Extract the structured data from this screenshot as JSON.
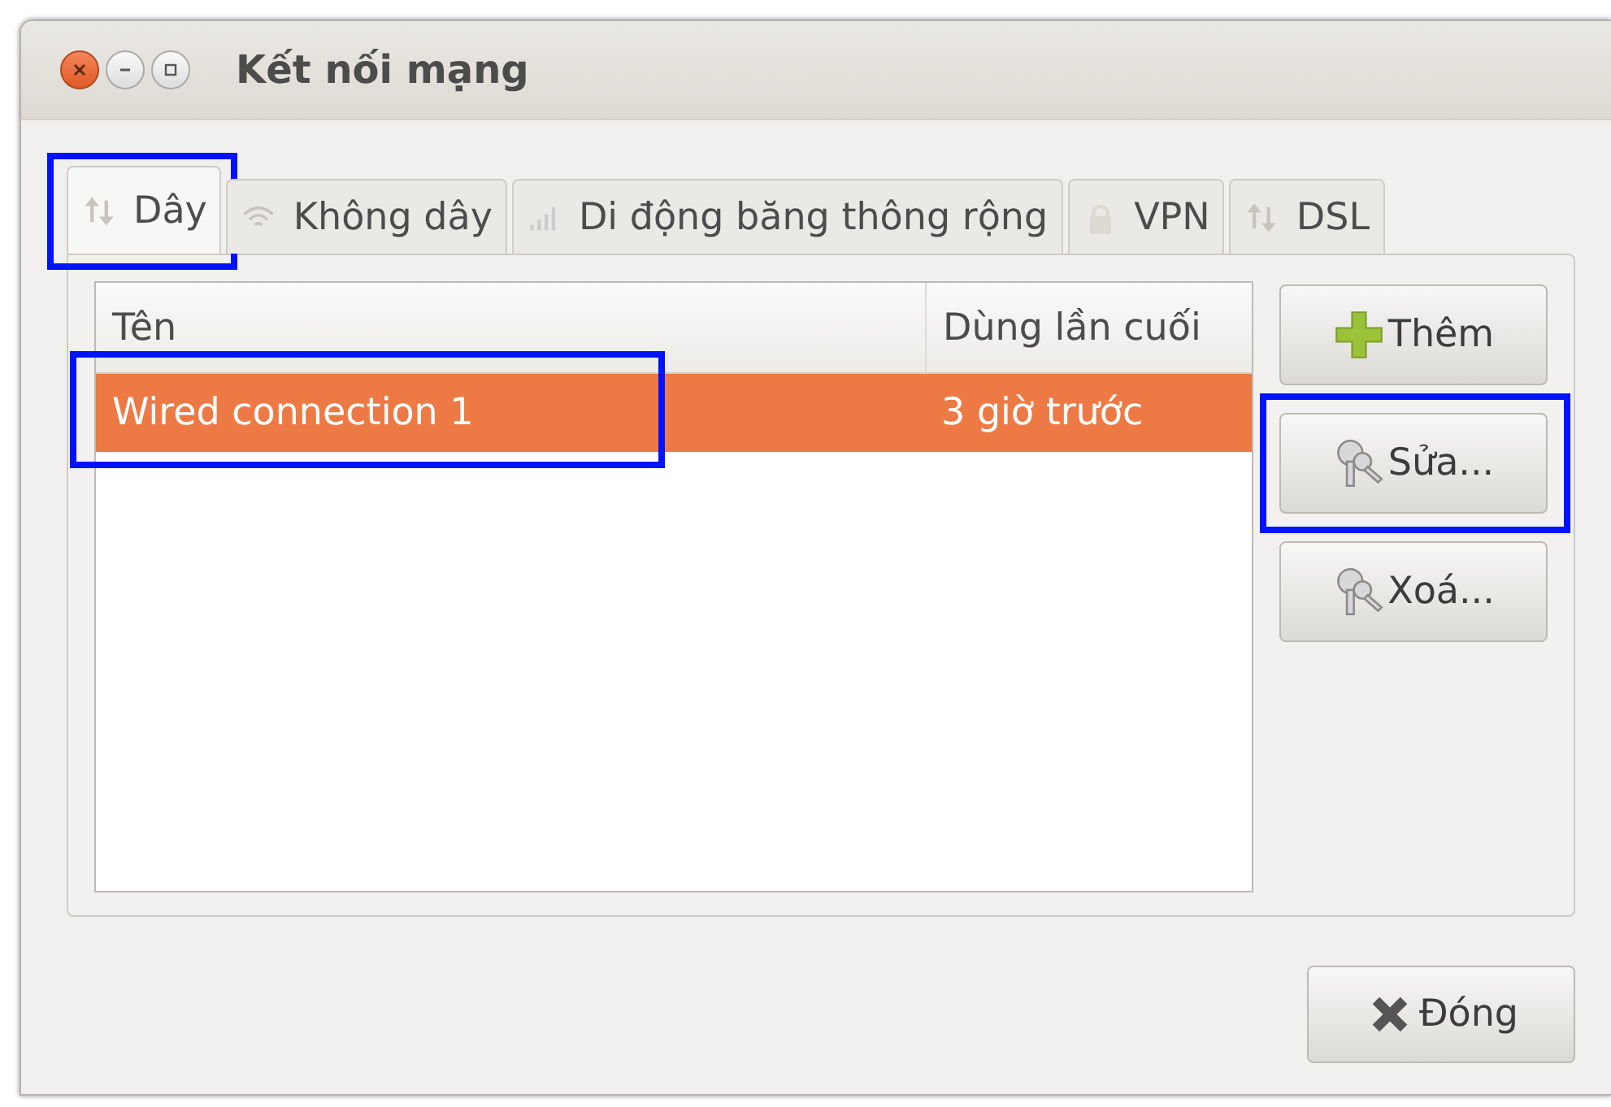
{
  "window": {
    "title": "Kết nối mạng"
  },
  "tabs": [
    {
      "label": "Dây",
      "selected": true,
      "highlighted": true
    },
    {
      "label": "Không dây",
      "selected": false,
      "highlighted": false
    },
    {
      "label": "Di động băng thông rộng",
      "selected": false,
      "highlighted": false
    },
    {
      "label": "VPN",
      "selected": false,
      "highlighted": false
    },
    {
      "label": "DSL",
      "selected": false,
      "highlighted": false
    }
  ],
  "table": {
    "columns": [
      "Tên",
      "Dùng lần cuối"
    ],
    "rows": [
      {
        "cells": [
          "Wired connection 1",
          "3 giờ trước"
        ],
        "selected": true,
        "highlighted": true
      }
    ]
  },
  "side_buttons": [
    {
      "label": "Thêm",
      "highlighted": false
    },
    {
      "label": "Sửa...",
      "highlighted": true
    },
    {
      "label": "Xoá...",
      "highlighted": false
    }
  ],
  "close_button": {
    "label": "Đóng"
  }
}
